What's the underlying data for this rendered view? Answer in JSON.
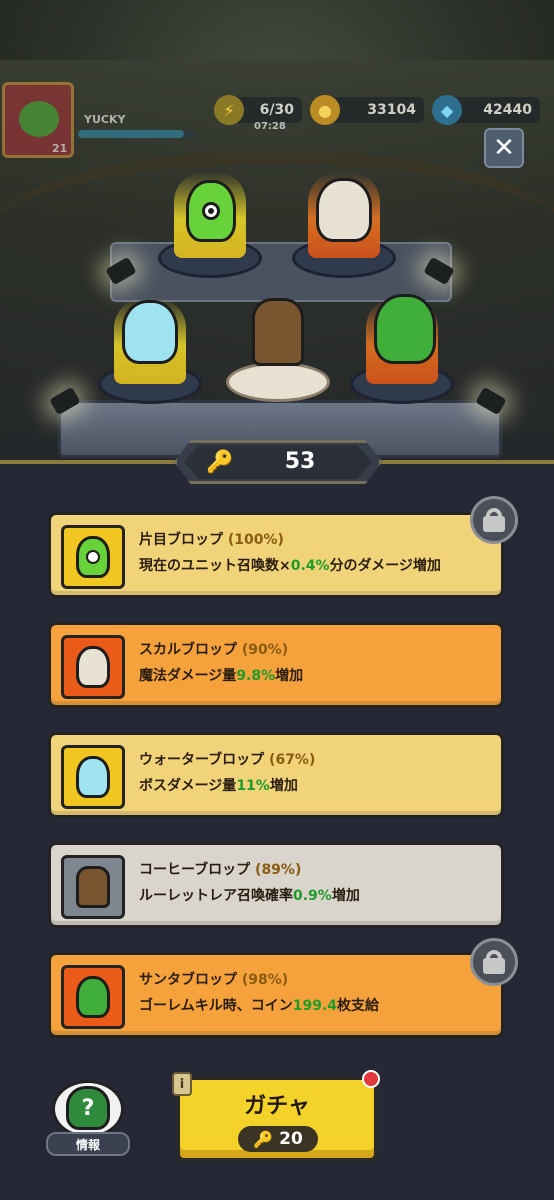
{
  "hud": {
    "player_name": "YUCKY",
    "player_level": "21",
    "energy": "6/30",
    "energy_timer": "07:28",
    "coins": "33104",
    "gems": "42440"
  },
  "keys": {
    "count": "53"
  },
  "cards": [
    {
      "name": "片目ブロップ",
      "percent": "(100%)",
      "desc_pre": "現在のユニット召喚数×",
      "desc_value": "0.4%",
      "desc_post": "分のダメージ増加",
      "locked": true
    },
    {
      "name": "スカルブロップ",
      "percent": "(90%)",
      "desc_pre": "魔法ダメージ量",
      "desc_value": "9.8%",
      "desc_post": "増加",
      "locked": false
    },
    {
      "name": "ウォーターブロップ",
      "percent": "(67%)",
      "desc_pre": "ボスダメージ量",
      "desc_value": "11%",
      "desc_post": "増加",
      "locked": false
    },
    {
      "name": "コーヒーブロップ",
      "percent": "(89%)",
      "desc_pre": "ルーレットレア召喚確率",
      "desc_value": "0.9%",
      "desc_post": "増加",
      "locked": false
    },
    {
      "name": "サンタブロップ",
      "percent": "(98%)",
      "desc_pre": "ゴーレムキル時、コイン",
      "desc_value": "199.4",
      "desc_post": "枚支給",
      "locked": true
    }
  ],
  "bottom": {
    "info_label": "情報",
    "gacha_label": "ガチャ",
    "gacha_cost": "20",
    "gacha_info_glyph": "i"
  },
  "colors": {
    "card_yellow": "#f1d37a",
    "card_orange": "#f5a23c",
    "card_gray": "#d9d4cc",
    "highlight_green": "#1f9b2a",
    "gacha_yellow": "#f3d32a"
  }
}
